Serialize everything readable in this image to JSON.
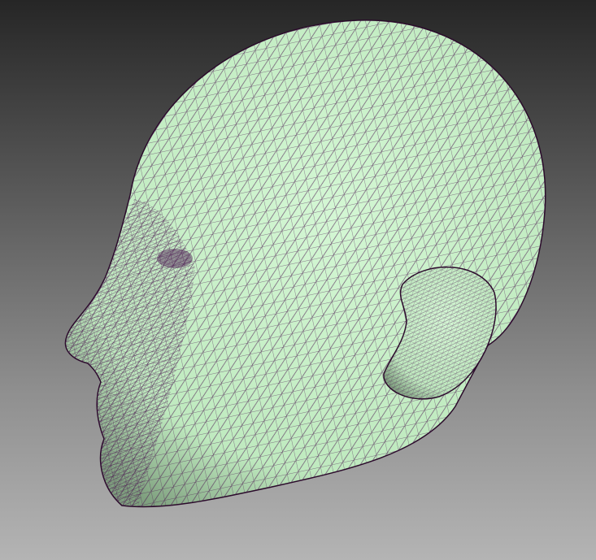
{
  "viewport": {
    "background_top": "#262626",
    "background_bottom": "#b4b4b4"
  },
  "model": {
    "type": "wireframe-shaded-head-mesh",
    "surface_color": "#c8f2c8",
    "wire_color": "#4a1450"
  }
}
